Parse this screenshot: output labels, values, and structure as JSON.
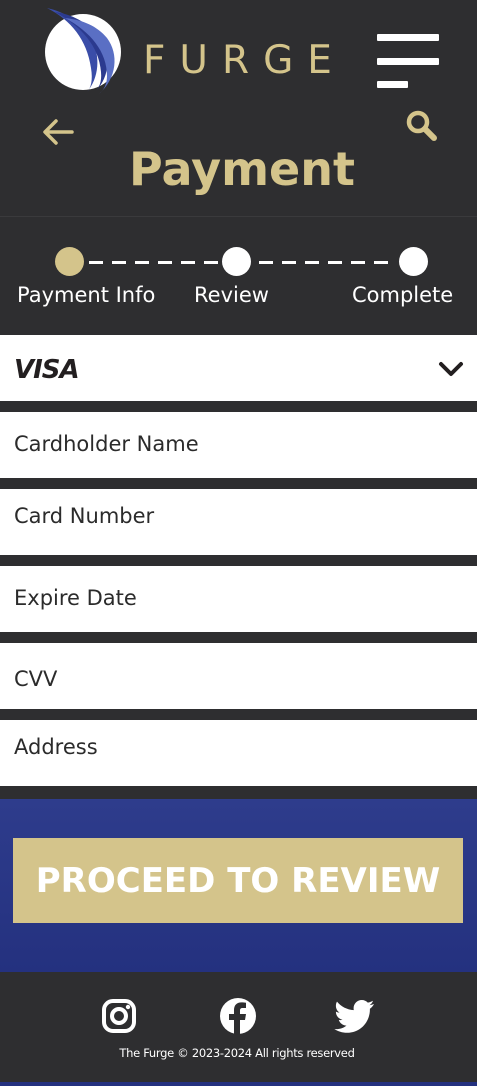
{
  "header": {
    "brand": "FURGE",
    "logo_icon": "furge-feather-logo-icon",
    "menu_icon": "hamburger-menu-icon",
    "back_icon": "arrow-left-icon",
    "search_icon": "search-icon",
    "page_title": "Payment"
  },
  "progress": {
    "steps": [
      {
        "label": "Payment Info",
        "state": "active"
      },
      {
        "label": "Review",
        "state": "pending"
      },
      {
        "label": "Complete",
        "state": "pending"
      }
    ]
  },
  "form": {
    "card_type": {
      "selected": "VISA",
      "icon": "chevron-down-icon"
    },
    "cardholder_name": {
      "placeholder": "Cardholder Name",
      "value": ""
    },
    "card_number": {
      "placeholder": "Card Number",
      "value": ""
    },
    "expire_date": {
      "placeholder": "Expire Date",
      "value": ""
    },
    "cvv": {
      "placeholder": "CVV",
      "value": ""
    },
    "address": {
      "placeholder": "Address",
      "value": ""
    }
  },
  "cta": {
    "label": "PROCEED TO REVIEW"
  },
  "footer": {
    "social_icons": [
      "instagram-icon",
      "facebook-icon",
      "twitter-icon"
    ],
    "copyright": "The Furge © 2023-2024 All rights reserved"
  },
  "colors": {
    "background": "#2e2e30",
    "accent_gold": "#d4c48b",
    "cta_band_blue": "#2e3c8c",
    "white": "#ffffff"
  }
}
